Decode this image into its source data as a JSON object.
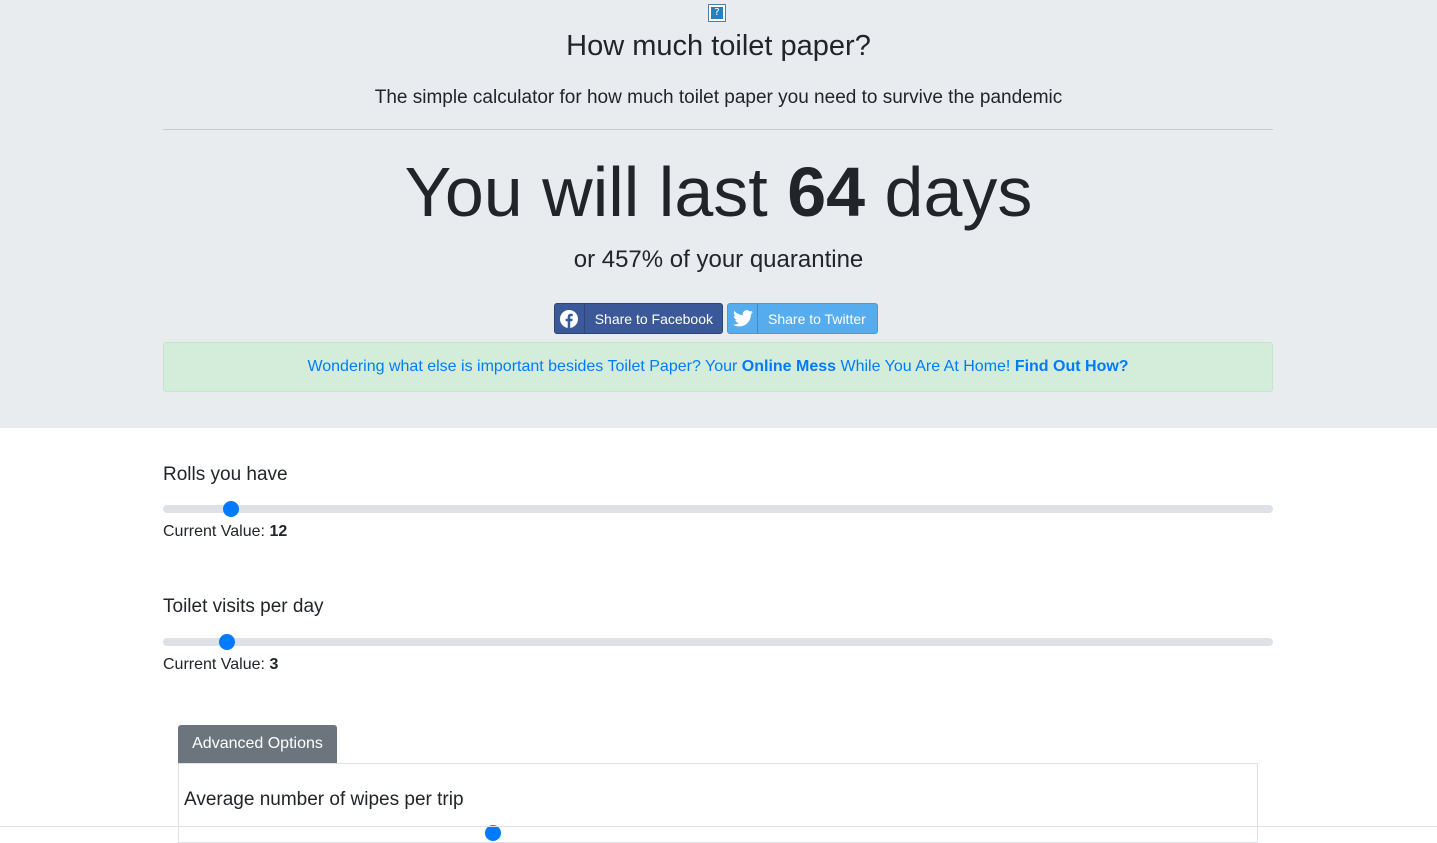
{
  "header": {
    "logo_icon": "help-box-icon",
    "title": "How much toilet paper?",
    "lead": "The simple calculator for how much toilet paper you need to survive the pandemic"
  },
  "result": {
    "prefix": "You will last",
    "days": "64",
    "suffix": "days",
    "sub_prefix": "or",
    "percent": "457%",
    "sub_suffix": "of your quarantine"
  },
  "share": {
    "facebook_label": "Share to Facebook",
    "facebook_icon": "facebook-icon",
    "twitter_label": "Share to Twitter",
    "twitter_icon": "twitter-icon",
    "facebook_color": "#3b5998",
    "twitter_color": "#55acee"
  },
  "alert": {
    "text_1": "Wondering what else is important besides Toilet Paper? Your",
    "bold": "Online Mess",
    "text_2": "While You Are At Home!",
    "link": "Find Out How?"
  },
  "sliders": {
    "rolls": {
      "label": "Rolls you have",
      "current_label": "Current Value:",
      "value": "12",
      "fraction": 0.061
    },
    "visits": {
      "label": "Toilet visits per day",
      "current_label": "Current Value:",
      "value": "3",
      "fraction": 0.058
    }
  },
  "advanced": {
    "button_label": "Advanced Options",
    "wipes_label": "Average number of wipes per trip"
  },
  "colors": {
    "accent": "#007bff",
    "hero_bg": "#e9ecef",
    "alert_bg": "#d4edda",
    "button_gray": "#6c757d"
  }
}
